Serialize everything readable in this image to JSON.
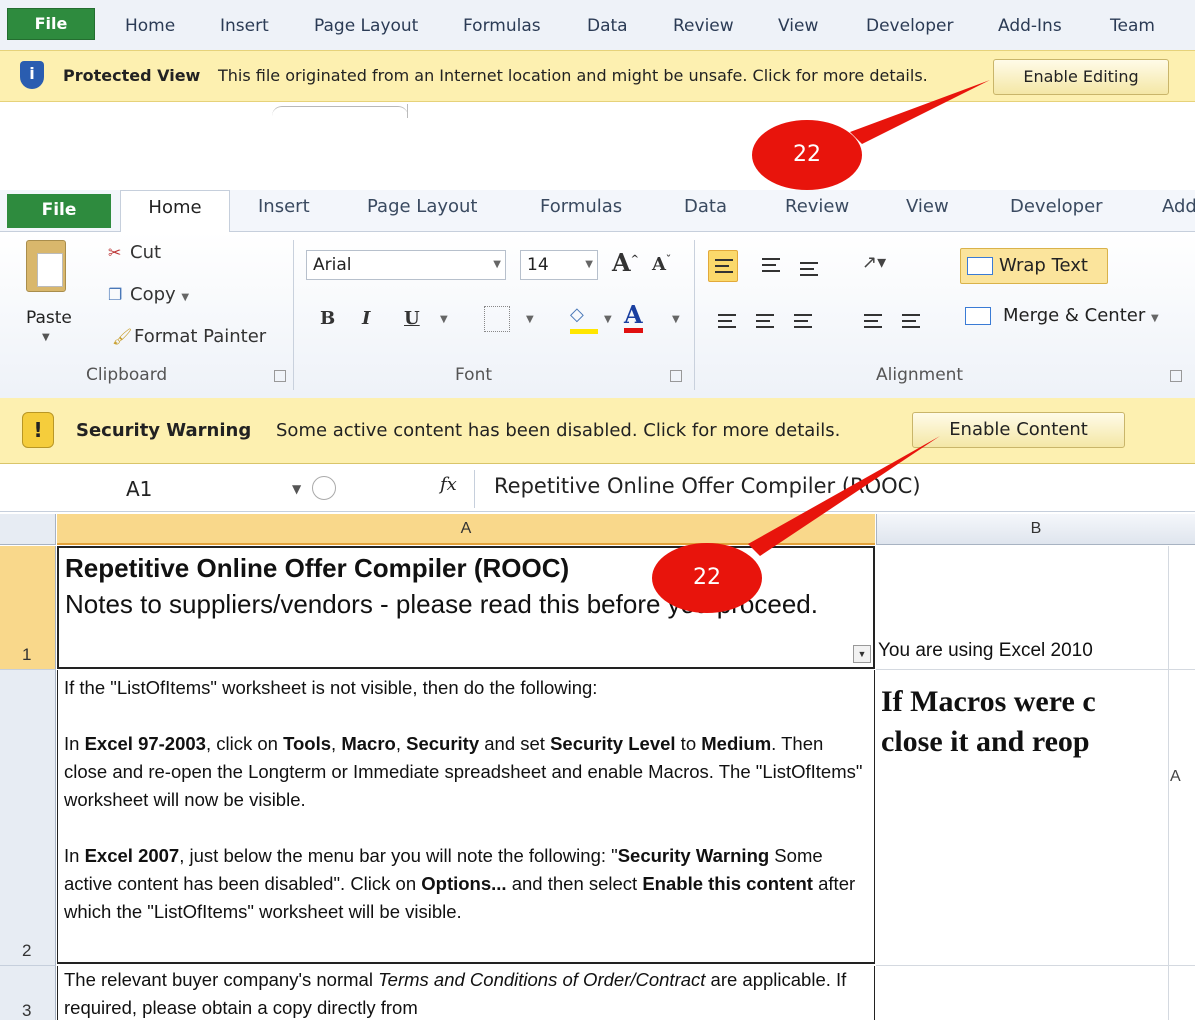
{
  "top_ribbon": {
    "tabs": [
      "File",
      "Home",
      "Insert",
      "Page Layout",
      "Formulas",
      "Data",
      "Review",
      "View",
      "Developer",
      "Add-Ins",
      "Team"
    ],
    "protected_view": {
      "title": "Protected View",
      "message": "This file originated from an Internet location and might be unsafe. Click for more details.",
      "button": "Enable Editing"
    }
  },
  "annotations": {
    "badge_top": "22",
    "badge_cell": "22",
    "color": "#e8140c"
  },
  "ribbon": {
    "tabs": [
      "File",
      "Home",
      "Insert",
      "Page Layout",
      "Formulas",
      "Data",
      "Review",
      "View",
      "Developer",
      "Add"
    ],
    "clipboard": {
      "paste": "Paste",
      "cut": "Cut",
      "copy": "Copy",
      "format_painter": "Format Painter",
      "group_label": "Clipboard"
    },
    "font": {
      "name": "Arial",
      "size": "14",
      "bold": "B",
      "italic": "I",
      "underline": "U",
      "grow": "A",
      "shrink": "A",
      "color": "A",
      "group_label": "Font"
    },
    "alignment": {
      "wrap_text": "Wrap Text",
      "merge_center": "Merge & Center",
      "group_label": "Alignment"
    }
  },
  "security_warning": {
    "title": "Security Warning",
    "message": "Some active content has been disabled. Click for more details.",
    "button": "Enable Content"
  },
  "formula_bar": {
    "name_box": "A1",
    "fx": "fx",
    "formula": "Repetitive Online Offer Compiler (ROOC)"
  },
  "grid": {
    "columns": [
      "A",
      "B"
    ],
    "rows": [
      "1",
      "2",
      "3"
    ],
    "a1_title": "Repetitive Online Offer Compiler (ROOC)",
    "a1_subtitle": "Notes to suppliers/vendors - please read this before you proceed.",
    "b1": "You are using Excel 2010",
    "a2": {
      "p1": "If the \"ListOfItems\" worksheet is not visible, then do the following:",
      "p2_a": "In ",
      "p2_b": "Excel 97-2003",
      "p2_c": ", click on ",
      "p2_d": "Tools",
      "p2_e": ", ",
      "p2_f": "Macro",
      "p2_g": ", ",
      "p2_h": "Security",
      "p2_i": " and set ",
      "p2_j": "Security Level",
      "p2_k": " to ",
      "p2_l": "Medium",
      "p2_m": ". Then close and re-open the Longterm or Immediate spreadsheet and enable Macros. The \"ListOfItems\" worksheet will now be visible.",
      "p3_a": "In ",
      "p3_b": "Excel 2007",
      "p3_c": ", just below the menu bar you will note the following: \"",
      "p3_d": "Security Warning",
      "p3_e": " Some active content has been disabled\". Click on ",
      "p3_f": "Options...",
      "p3_g": " and then select ",
      "p3_h": "Enable this content",
      "p3_i": " after which the \"ListOfItems\" worksheet will be visible."
    },
    "b2_line1": "If Macros were c",
    "b2_line2": "close it and reop",
    "a3": {
      "t1": "The relevant buyer company's normal ",
      "t2": "Terms and Conditions of Order/Contract",
      "t3": " are applicable. If required, please obtain a copy directly from"
    },
    "stray_label": "A"
  }
}
